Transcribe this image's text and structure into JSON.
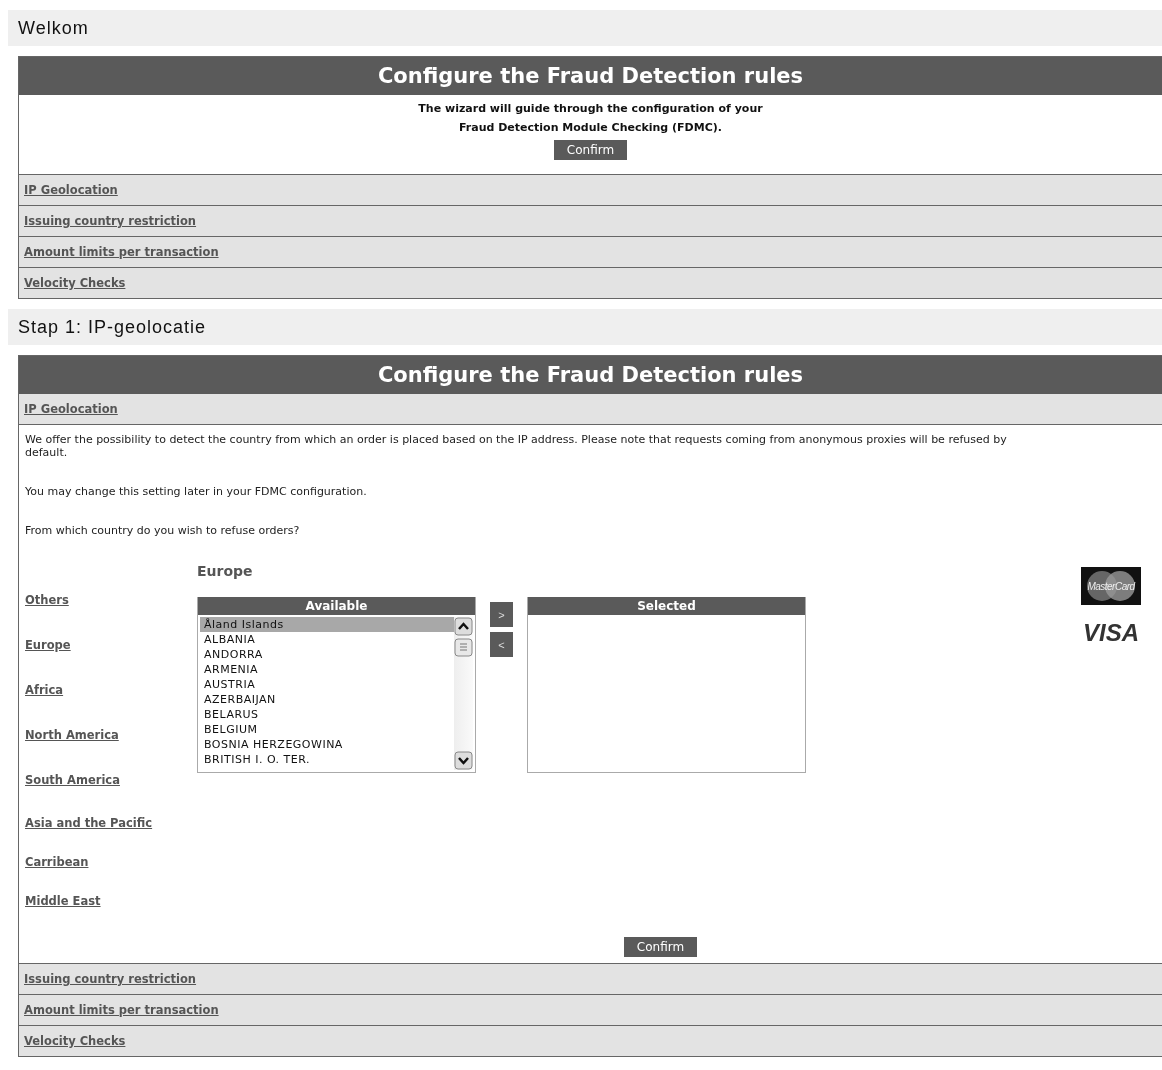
{
  "sections": [
    {
      "heading": "Welkom",
      "panel": {
        "title": "Configure the Fraud Detection rules",
        "kind": "intro",
        "intro_lines": [
          "The wizard will guide through the configuration of your",
          "Fraud Detection Module Checking (FDMC)."
        ],
        "confirm": "Confirm",
        "steps_after": [
          "IP Geolocation",
          "Issuing country restriction",
          "Amount limits per transaction",
          "Velocity Checks"
        ]
      }
    },
    {
      "heading": "Stap 1: IP-geolocatie",
      "panel": {
        "title": "Configure the Fraud Detection rules",
        "kind": "step",
        "step_title": "IP Geolocation",
        "paragraphs": [
          "We offer the possibility to detect the country from which an order is placed based on the IP address. Please note that requests coming from anonymous proxies will be refused by default.",
          "You may change this setting later in your FDMC configuration.",
          "From which country do you wish to refuse orders?"
        ],
        "regions": [
          "Others",
          "Europe",
          "Africa",
          "North America",
          "South America",
          "Asia and the Pacific",
          "Carribean",
          "Middle East"
        ],
        "region_heading": "Europe",
        "available": {
          "title": "Available",
          "options": [
            {
              "label": "Åland Islands",
              "selected": true
            },
            {
              "label": "ALBANIA",
              "selected": false
            },
            {
              "label": "ANDORRA",
              "selected": false
            },
            {
              "label": "ARMENIA",
              "selected": false
            },
            {
              "label": "AUSTRIA",
              "selected": false
            },
            {
              "label": "AZERBAIJAN",
              "selected": false
            },
            {
              "label": "BELARUS",
              "selected": false
            },
            {
              "label": "BELGIUM",
              "selected": false
            },
            {
              "label": "BOSNIA HERZEGOWINA",
              "selected": false
            },
            {
              "label": "BRITISH I. O. TER.",
              "selected": false
            }
          ]
        },
        "move_buttons": [
          ">",
          "<"
        ],
        "selected_list": {
          "title": "Selected"
        },
        "card_logos": [
          "MasterCard",
          "VISA"
        ],
        "confirm": "Confirm",
        "steps_after": [
          "Issuing country restriction",
          "Amount limits per transaction",
          "Velocity Checks"
        ]
      }
    }
  ]
}
